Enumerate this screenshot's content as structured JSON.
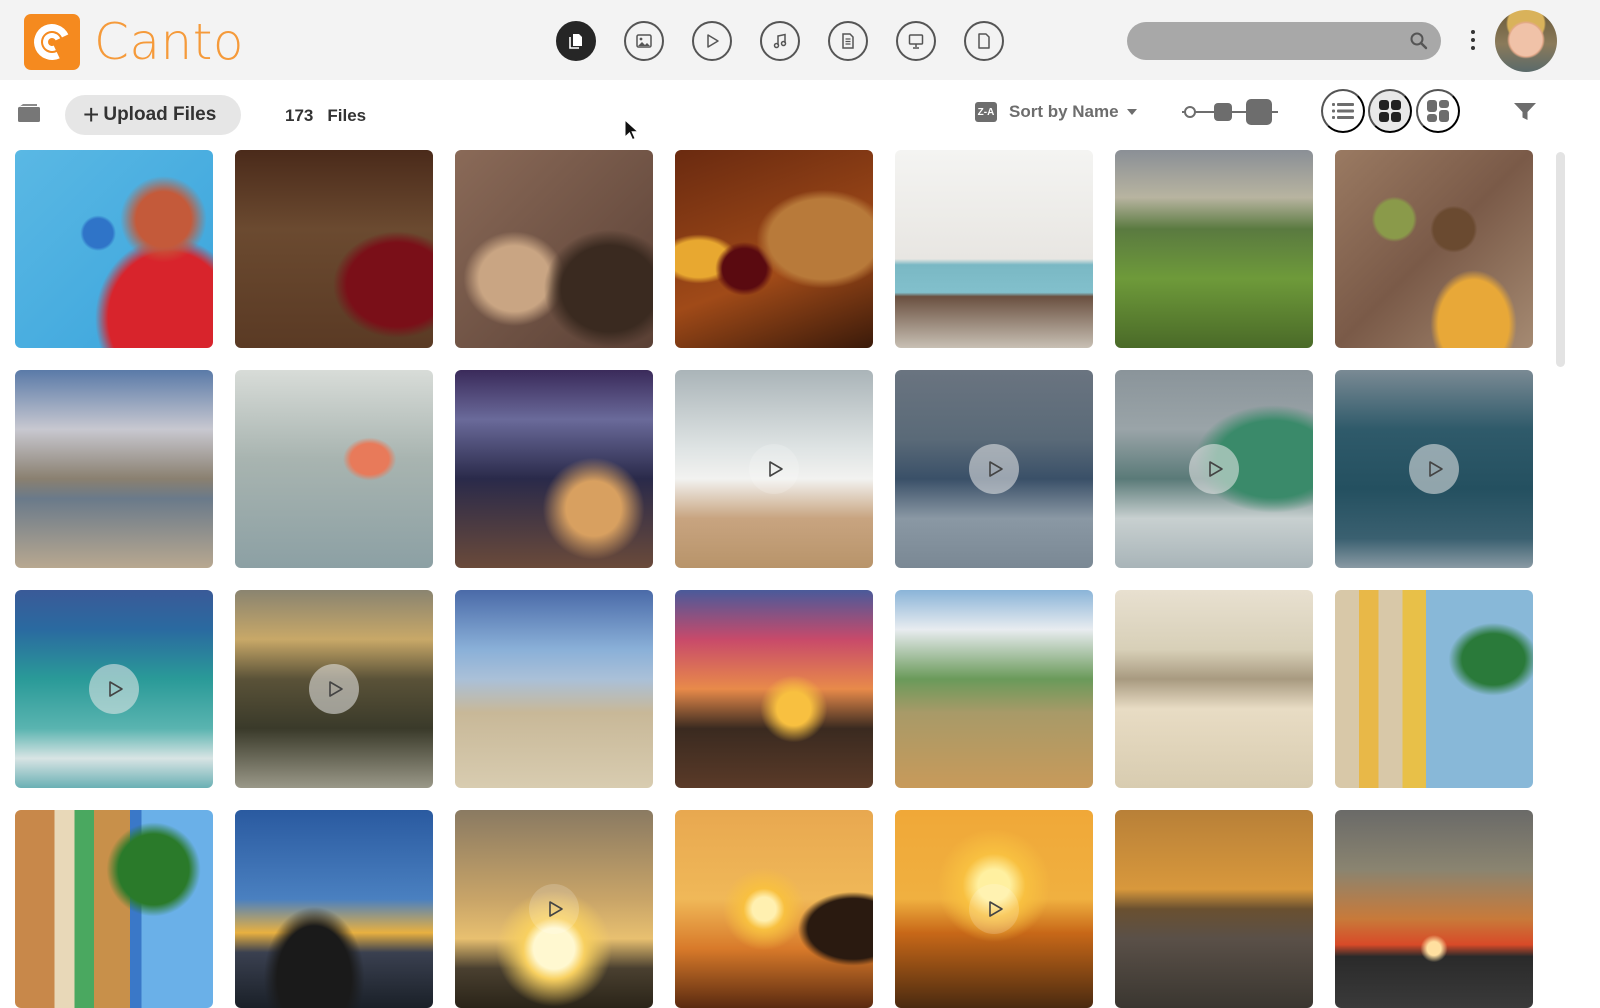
{
  "header": {
    "brand": "Canto",
    "brand_color": "#f58a1f",
    "type_filters": [
      {
        "name": "all-files",
        "icon": "files-icon",
        "active": true
      },
      {
        "name": "images",
        "icon": "image-icon",
        "active": false
      },
      {
        "name": "videos",
        "icon": "play-icon",
        "active": false
      },
      {
        "name": "audio",
        "icon": "music-icon",
        "active": false
      },
      {
        "name": "documents",
        "icon": "document-icon",
        "active": false
      },
      {
        "name": "presentations",
        "icon": "presentation-icon",
        "active": false
      },
      {
        "name": "others",
        "icon": "file-icon",
        "active": false
      }
    ],
    "search": {
      "value": "",
      "placeholder": ""
    },
    "menu_icon": "kebab-icon",
    "avatar_icon": "user-avatar"
  },
  "toolbar": {
    "upload_label": "Upload Files",
    "file_count": "173",
    "file_count_label": "Files",
    "sort_badge": "Z-A",
    "sort_label": "Sort by Name",
    "thumbnail_size": "large",
    "view_mode": "grid",
    "view_modes": [
      "list",
      "grid",
      "masonry"
    ]
  },
  "grid": {
    "columns": 7,
    "tiles": [
      {
        "subject": "woman-with-alarm-clock",
        "video": false
      },
      {
        "subject": "red-wine-pouring",
        "video": false
      },
      {
        "subject": "corkscrew-and-corks",
        "video": false
      },
      {
        "subject": "beer-wine-barrel",
        "video": false
      },
      {
        "subject": "white-kitchen",
        "video": false
      },
      {
        "subject": "vineyard",
        "video": false
      },
      {
        "subject": "food-table-overhead",
        "video": false
      },
      {
        "subject": "bridge-city-skyline",
        "video": false
      },
      {
        "subject": "surfer-holding-board",
        "video": false
      },
      {
        "subject": "hillside-town-dusk",
        "video": false
      },
      {
        "subject": "surfer-walking-into-waves",
        "video": true
      },
      {
        "subject": "surfer-riding-wave",
        "video": true
      },
      {
        "subject": "breaking-wave-green",
        "video": true
      },
      {
        "subject": "surfer-in-barrel",
        "video": true
      },
      {
        "subject": "surfer-turquoise-wave",
        "video": true
      },
      {
        "subject": "golden-wave-barrel",
        "video": true
      },
      {
        "subject": "beach-hut",
        "video": false
      },
      {
        "subject": "friends-at-sunset",
        "video": false
      },
      {
        "subject": "surfboards-on-fence",
        "video": false
      },
      {
        "subject": "surfers-on-beach",
        "video": false
      },
      {
        "subject": "surfboards-and-palms",
        "video": false
      },
      {
        "subject": "surfboard-rack-palms",
        "video": false
      },
      {
        "subject": "surfboard-fin-sunset",
        "video": false
      },
      {
        "subject": "ocean-sunset",
        "video": true
      },
      {
        "subject": "beach-sunset-headland",
        "video": false
      },
      {
        "subject": "silhouettes-with-dog",
        "video": true
      },
      {
        "subject": "golden-gate-sunset",
        "video": false
      },
      {
        "subject": "cloudy-sea-sunset",
        "video": false
      }
    ]
  }
}
